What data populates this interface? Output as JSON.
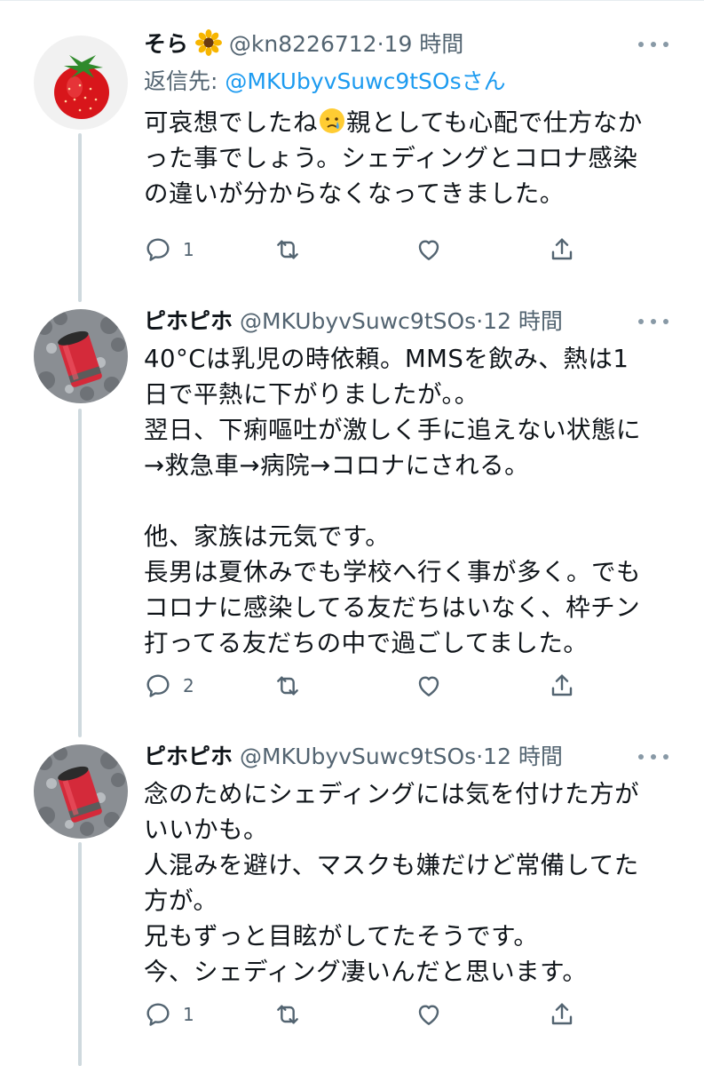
{
  "tweets": [
    {
      "name": "そら",
      "handle": "@kn8226712",
      "dot": "·",
      "time": "19 時間",
      "reply_label": "返信先:",
      "reply_mention": "@MKUbyvSuwc9tSOs",
      "reply_suffix": "さん",
      "lines": [
        {
          "pre": "可哀想でしたね",
          "post": "親としても心配で仕方なか"
        },
        {
          "text": "った事でしょう。シェディングとコロナ感染"
        },
        {
          "text": "の違いが分からなくなってきました。"
        }
      ],
      "reply_count": "1"
    },
    {
      "name": "ピホピホ",
      "handle": "@MKUbyvSuwc9tSOs",
      "dot": "·",
      "time": "12 時間",
      "lines": [
        {
          "text": "40°Cは乳児の時依頼。MMSを飲み、熱は1"
        },
        {
          "text": "日で平熱に下がりましたが。。"
        },
        {
          "text": "翌日、下痢嘔吐が激しく手に追えない状態に"
        },
        {
          "text": "→救急車→病院→コロナにされる。"
        },
        {
          "text": ""
        },
        {
          "text": "他、家族は元気です。"
        },
        {
          "text": "長男は夏休みでも学校へ行く事が多く。でも"
        },
        {
          "text": "コロナに感染してる友だちはいなく、枠チン"
        },
        {
          "text": "打ってる友だちの中で過ごしてました。"
        }
      ],
      "reply_count": "2"
    },
    {
      "name": "ピホピホ",
      "handle": "@MKUbyvSuwc9tSOs",
      "dot": "·",
      "time": "12 時間",
      "lines": [
        {
          "text": "念のためにシェディングには気を付けた方が"
        },
        {
          "text": "いいかも。"
        },
        {
          "text": "人混みを避け、マスクも嫌だけど常備してた"
        },
        {
          "text": "方が。"
        },
        {
          "text": "兄もずっと目眩がしてたそうです。"
        },
        {
          "text": "今、シェディング凄いんだと思います。"
        }
      ],
      "reply_count": "1"
    }
  ],
  "icons": {
    "reply": "reply-icon",
    "retweet": "retweet-icon",
    "like": "heart-icon",
    "share": "share-icon",
    "more": "more-icon",
    "emoji": "crying-face-emoji",
    "name_emoji": "sunflower-emoji"
  },
  "colors": {
    "link": "#1d9bf0",
    "muted": "#536471",
    "thread_line": "#cfd9de"
  }
}
